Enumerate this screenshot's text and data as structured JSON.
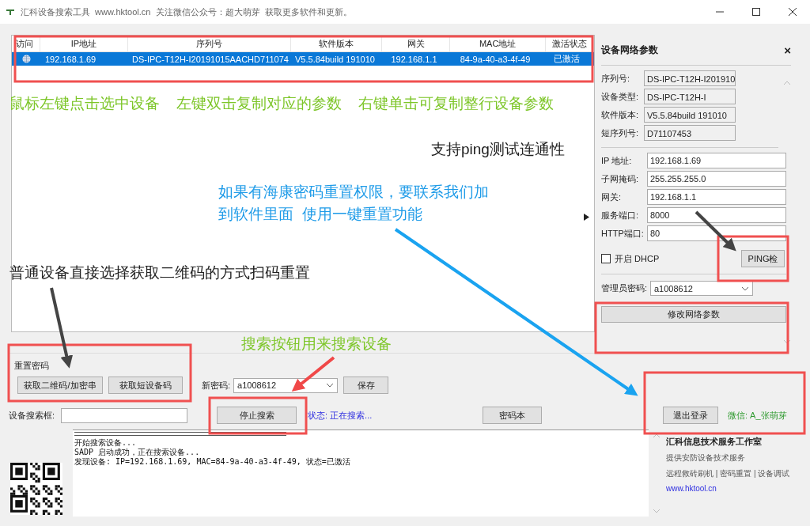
{
  "window": {
    "title": "汇科设备搜索工具  www.hktool.cn  关注微信公众号：超大萌芽  获取更多软件和更新。"
  },
  "device_table": {
    "columns": [
      "访问",
      "IP地址",
      "序列号",
      "软件版本",
      "网关",
      "MAC地址",
      "激活状态"
    ],
    "rows": [
      {
        "selected": true,
        "cells": [
          "",
          "192.168.1.69",
          "DS-IPC-T12H-I20191015AACHD711074",
          "V5.5.84build 191010",
          "192.168.1.1",
          "84-9a-40-a3-4f-49",
          "已激活"
        ]
      }
    ]
  },
  "network_panel": {
    "title": "设备网络参数",
    "close": "×",
    "info": [
      {
        "label": "序列号:",
        "value": "DS-IPC-T12H-I201910"
      },
      {
        "label": "设备类型:",
        "value": "DS-IPC-T12H-I"
      },
      {
        "label": "软件版本:",
        "value": "V5.5.84build 191010"
      },
      {
        "label": "短序列号:",
        "value": "D71107453"
      }
    ],
    "fields": [
      {
        "label": "IP 地址:",
        "value": "192.168.1.69"
      },
      {
        "label": "子网掩码:",
        "value": "255.255.255.0"
      },
      {
        "label": "网关:",
        "value": "192.168.1.1"
      },
      {
        "label": "服务端口:",
        "value": "8000"
      },
      {
        "label": "HTTP端口:",
        "value": "80"
      }
    ],
    "dhcp": {
      "label": "开启 DHCP",
      "checked": false
    },
    "ping_button": "PING检",
    "admin_password": {
      "label": "管理员密码:",
      "value": "a1008612"
    },
    "apply_button": "修改网络参数"
  },
  "reset": {
    "title": "重置密码",
    "buttons": [
      "获取二维码/加密串",
      "获取短设备码"
    ],
    "new_password": {
      "label": "新密码:",
      "value": "a1008612"
    },
    "save_button": "保存"
  },
  "search": {
    "label": "设备搜索框:",
    "stop_button": "停止搜索",
    "status": "状态: 正在搜索...",
    "codebook_button": "密码本",
    "logout_button": "退出登录",
    "wechat": "微信: A_张萌芽"
  },
  "log": {
    "lines": [
      "开始搜索设备...",
      "SADP 启动成功，正在搜索设备...",
      "发现设备: IP=192.168.1.69, MAC=84-9a-40-a3-4f-49, 状态=已激活"
    ]
  },
  "info_panel": {
    "title": "汇科信息技术服务工作室",
    "lines": [
      "提供安防设备技术服务",
      "远程救砖刷机 | 密码重置 | 设备调试"
    ],
    "link": "www.hktool.cn"
  },
  "annotations": [
    {
      "text": "鼠标左键点击选中设备    左键双击复制对应的参数    右键单击可复制整行设备参数",
      "color": "#7dc629"
    },
    {
      "text": "支持ping测试连通性",
      "color": "#222222"
    },
    {
      "text": "如果有海康密码重置权限，要联系我们加",
      "color": "#1e9be8"
    },
    {
      "text": "到软件里面  使用一键重置功能",
      "color": "#1e9be8"
    },
    {
      "text": "普通设备直接选择获取二维码的方式扫码重置",
      "color": "#222222"
    },
    {
      "text": "搜索按钮用来搜索设备",
      "color": "#7dc629"
    }
  ]
}
